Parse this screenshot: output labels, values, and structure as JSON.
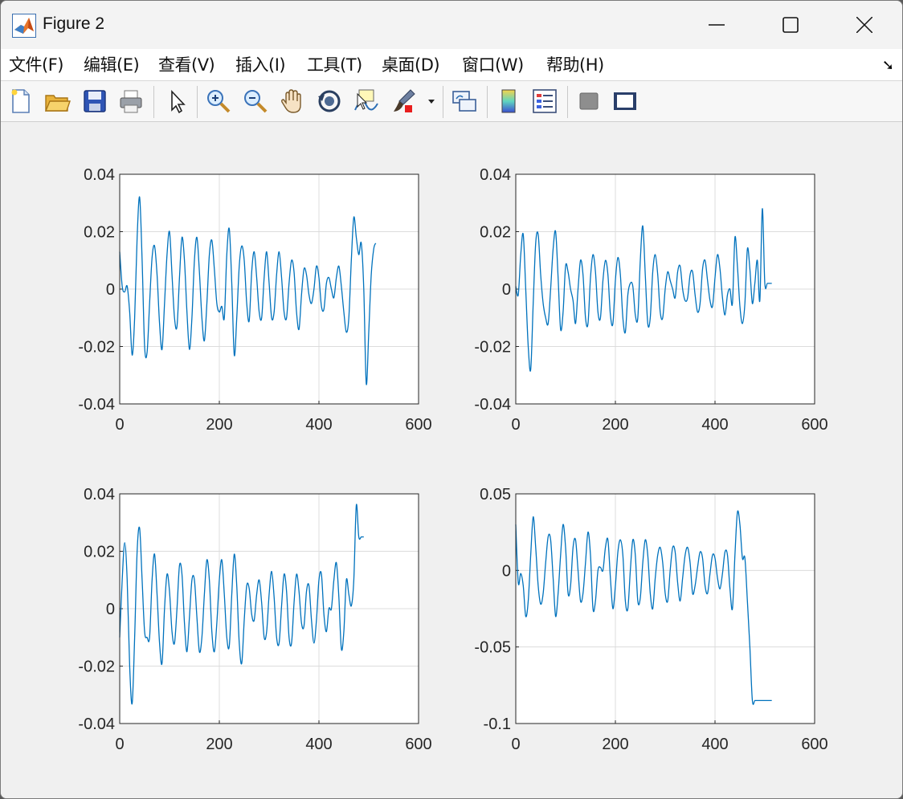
{
  "window": {
    "title": "Figure 2"
  },
  "menu": [
    {
      "label": "文件(F)"
    },
    {
      "label": "编辑(E)"
    },
    {
      "label": "查看(V)"
    },
    {
      "label": "插入(I)"
    },
    {
      "label": "工具(T)"
    },
    {
      "label": "桌面(D)"
    },
    {
      "label": "窗口(W)"
    },
    {
      "label": "帮助(H)"
    }
  ],
  "toolbar": [
    {
      "name": "new-figure-icon"
    },
    {
      "name": "open-file-icon"
    },
    {
      "name": "save-icon"
    },
    {
      "name": "print-icon"
    },
    {
      "name": "select-pointer-icon"
    },
    {
      "name": "zoom-in-icon"
    },
    {
      "name": "zoom-out-icon"
    },
    {
      "name": "pan-hand-icon"
    },
    {
      "name": "rotate-3d-icon"
    },
    {
      "name": "data-cursor-icon"
    },
    {
      "name": "brush-icon"
    },
    {
      "name": "link-plot-icon"
    },
    {
      "name": "colorbar-icon"
    },
    {
      "name": "legend-icon"
    },
    {
      "name": "hide-plot-tools-icon"
    },
    {
      "name": "show-plot-tools-icon"
    }
  ],
  "colors": {
    "line": "#0072BD",
    "grid": "#dcdcdc",
    "axes_bg": "#ffffff"
  },
  "chart_data": [
    {
      "type": "line",
      "xlim": [
        0,
        600
      ],
      "ylim": [
        -0.04,
        0.04
      ],
      "xticks": [
        "0",
        "200",
        "400",
        "600"
      ],
      "yticks": [
        "0.04",
        "0.02",
        "0",
        "-0.02",
        "-0.04"
      ],
      "x": [
        0,
        5,
        10,
        15,
        20,
        25,
        30,
        35,
        40,
        45,
        50,
        55,
        60,
        65,
        70,
        75,
        80,
        85,
        90,
        95,
        100,
        105,
        110,
        115,
        120,
        125,
        130,
        135,
        140,
        145,
        150,
        155,
        160,
        165,
        170,
        175,
        180,
        185,
        190,
        195,
        200,
        205,
        210,
        215,
        220,
        225,
        230,
        235,
        240,
        245,
        250,
        255,
        260,
        265,
        270,
        275,
        280,
        285,
        290,
        295,
        300,
        305,
        310,
        315,
        320,
        325,
        330,
        335,
        340,
        345,
        350,
        355,
        360,
        365,
        370,
        375,
        380,
        385,
        390,
        395,
        400,
        405,
        410,
        415,
        420,
        425,
        430,
        435,
        440,
        445,
        450,
        455,
        460,
        465,
        470,
        475,
        480,
        485,
        490,
        495,
        500,
        505,
        510,
        514
      ],
      "y": [
        0.013,
        0.001,
        -0.001,
        0.001,
        -0.008,
        -0.023,
        -0.01,
        0.018,
        0.032,
        0.01,
        -0.02,
        -0.022,
        -0.005,
        0.011,
        0.015,
        0.005,
        -0.012,
        -0.021,
        -0.005,
        0.012,
        0.02,
        0.005,
        -0.01,
        -0.013,
        0.004,
        0.018,
        0.01,
        -0.008,
        -0.021,
        -0.01,
        0.01,
        0.018,
        0.006,
        -0.01,
        -0.018,
        -0.005,
        0.012,
        0.017,
        0.007,
        -0.005,
        -0.008,
        -0.006,
        -0.01,
        0.012,
        0.021,
        0.002,
        -0.023,
        -0.01,
        0.008,
        0.015,
        0.01,
        -0.005,
        -0.011,
        0.006,
        0.013,
        0.004,
        -0.008,
        -0.01,
        0.004,
        0.013,
        0.002,
        -0.01,
        -0.008,
        0.005,
        0.013,
        0.004,
        -0.008,
        -0.01,
        0.002,
        0.01,
        0.006,
        -0.008,
        -0.014,
        -0.002,
        0.007,
        0.005,
        -0.002,
        -0.005,
        0.0,
        0.008,
        0.004,
        -0.006,
        -0.007,
        0.002,
        0.004,
        0.0,
        -0.003,
        0.004,
        0.008,
        0.001,
        -0.008,
        -0.015,
        -0.01,
        0.01,
        0.025,
        0.018,
        0.012,
        0.016,
        0.0,
        -0.033,
        -0.015,
        0.005,
        0.014,
        0.016
      ],
      "draw_until": 514,
      "end_value": -0.033
    },
    {
      "type": "line",
      "xlim": [
        0,
        600
      ],
      "ylim": [
        -0.04,
        0.04
      ],
      "xticks": [
        "0",
        "200",
        "400",
        "600"
      ],
      "yticks": [
        "0.04",
        "0.02",
        "0",
        "-0.02",
        "-0.04"
      ],
      "x": [
        0,
        5,
        10,
        15,
        20,
        25,
        30,
        35,
        40,
        45,
        50,
        55,
        60,
        65,
        70,
        75,
        80,
        85,
        90,
        95,
        100,
        105,
        110,
        115,
        120,
        125,
        130,
        135,
        140,
        145,
        150,
        155,
        160,
        165,
        170,
        175,
        180,
        185,
        190,
        195,
        200,
        205,
        210,
        215,
        220,
        225,
        230,
        235,
        240,
        245,
        250,
        255,
        260,
        265,
        270,
        275,
        280,
        285,
        290,
        295,
        300,
        305,
        310,
        315,
        320,
        325,
        330,
        335,
        340,
        345,
        350,
        355,
        360,
        365,
        370,
        375,
        380,
        385,
        390,
        395,
        400,
        405,
        410,
        415,
        420,
        425,
        430,
        435,
        440,
        445,
        450,
        455,
        460,
        465,
        470,
        475,
        480,
        485,
        490,
        495,
        500,
        505,
        510,
        514
      ],
      "y": [
        0.001,
        -0.002,
        0.012,
        0.019,
        0.0,
        -0.02,
        -0.028,
        -0.005,
        0.016,
        0.019,
        0.005,
        -0.005,
        -0.01,
        -0.012,
        0.0,
        0.014,
        0.02,
        0.004,
        -0.014,
        -0.008,
        0.008,
        0.006,
        0.0,
        -0.004,
        -0.012,
        0.0,
        0.01,
        0.005,
        -0.01,
        -0.012,
        0.004,
        0.012,
        0.006,
        -0.008,
        -0.01,
        0.003,
        0.01,
        0.005,
        -0.009,
        -0.012,
        0.003,
        0.011,
        0.005,
        -0.01,
        -0.015,
        -0.002,
        0.002,
        0.001,
        -0.009,
        -0.01,
        0.01,
        0.022,
        0.005,
        -0.012,
        -0.01,
        0.006,
        0.012,
        0.005,
        -0.008,
        -0.01,
        0.0,
        0.006,
        0.003,
        0.0,
        -0.003,
        0.006,
        0.008,
        0.0,
        -0.004,
        -0.003,
        0.005,
        0.006,
        -0.002,
        -0.008,
        -0.005,
        0.007,
        0.01,
        0.003,
        -0.004,
        -0.006,
        0.004,
        0.012,
        0.007,
        -0.003,
        -0.009,
        -0.002,
        0.0,
        -0.005,
        0.018,
        0.008,
        -0.006,
        -0.012,
        -0.005,
        0.014,
        0.007,
        -0.005,
        0.002,
        0.01,
        -0.004,
        0.028,
        0.002,
        0.002,
        0.002,
        0.002
      ],
      "draw_until": 514,
      "end_value": 0.002
    },
    {
      "type": "line",
      "xlim": [
        0,
        600
      ],
      "ylim": [
        -0.04,
        0.04
      ],
      "xticks": [
        "0",
        "200",
        "400",
        "600"
      ],
      "yticks": [
        "0.04",
        "0.02",
        "0",
        "-0.02",
        "-0.04"
      ],
      "x": [
        0,
        5,
        10,
        15,
        20,
        25,
        30,
        35,
        40,
        45,
        50,
        55,
        60,
        65,
        70,
        75,
        80,
        85,
        90,
        95,
        100,
        105,
        110,
        115,
        120,
        125,
        130,
        135,
        140,
        145,
        150,
        155,
        160,
        165,
        170,
        175,
        180,
        185,
        190,
        195,
        200,
        205,
        210,
        215,
        220,
        225,
        230,
        235,
        240,
        245,
        250,
        255,
        260,
        265,
        270,
        275,
        280,
        285,
        290,
        295,
        300,
        305,
        310,
        315,
        320,
        325,
        330,
        335,
        340,
        345,
        350,
        355,
        360,
        365,
        370,
        375,
        380,
        385,
        390,
        395,
        400,
        405,
        410,
        415,
        420,
        425,
        430,
        435,
        440,
        445,
        450,
        455,
        460,
        465,
        470,
        475,
        480,
        485,
        490,
        495,
        500,
        505,
        510,
        514
      ],
      "y": [
        -0.01,
        0.01,
        0.023,
        0.01,
        -0.02,
        -0.033,
        -0.01,
        0.02,
        0.028,
        0.01,
        -0.008,
        -0.01,
        -0.01,
        0.01,
        0.019,
        0.005,
        -0.012,
        -0.019,
        0.0,
        0.012,
        0.006,
        -0.008,
        -0.012,
        0.0,
        0.015,
        0.012,
        -0.005,
        -0.015,
        -0.003,
        0.01,
        0.01,
        -0.003,
        -0.015,
        -0.01,
        0.005,
        0.017,
        0.01,
        -0.008,
        -0.015,
        -0.005,
        0.01,
        0.017,
        0.005,
        -0.01,
        -0.013,
        0.005,
        0.019,
        0.008,
        -0.012,
        -0.019,
        -0.004,
        0.008,
        0.007,
        -0.002,
        -0.004,
        0.005,
        0.01,
        0.002,
        -0.01,
        -0.008,
        0.005,
        0.013,
        0.004,
        -0.01,
        -0.012,
        0.001,
        0.012,
        0.006,
        -0.01,
        -0.012,
        0.002,
        0.012,
        0.006,
        -0.005,
        -0.006,
        0.006,
        0.008,
        -0.004,
        -0.012,
        -0.004,
        0.01,
        0.012,
        -0.002,
        -0.008,
        0.0,
        0.0,
        0.01,
        0.016,
        0.004,
        -0.014,
        -0.008,
        0.01,
        0.005,
        0.001,
        0.01,
        0.036,
        0.025,
        0.025,
        0.025,
        0.025
      ],
      "draw_until": 514,
      "end_value": 0.025
    },
    {
      "type": "line",
      "xlim": [
        0,
        600
      ],
      "ylim": [
        -0.1,
        0.05
      ],
      "xticks": [
        "0",
        "200",
        "400",
        "600"
      ],
      "yticks": [
        "0.05",
        "0",
        "-0.05",
        "-0.1"
      ],
      "x": [
        0,
        5,
        10,
        15,
        20,
        25,
        30,
        35,
        40,
        45,
        50,
        55,
        60,
        65,
        70,
        75,
        80,
        85,
        90,
        95,
        100,
        105,
        110,
        115,
        120,
        125,
        130,
        135,
        140,
        145,
        150,
        155,
        160,
        165,
        170,
        175,
        180,
        185,
        190,
        195,
        200,
        205,
        210,
        215,
        220,
        225,
        230,
        235,
        240,
        245,
        250,
        255,
        260,
        265,
        270,
        275,
        280,
        285,
        290,
        295,
        300,
        305,
        310,
        315,
        320,
        325,
        330,
        335,
        340,
        345,
        350,
        355,
        360,
        365,
        370,
        375,
        380,
        385,
        390,
        395,
        400,
        405,
        410,
        415,
        420,
        425,
        430,
        435,
        440,
        445,
        450,
        455,
        460,
        465,
        470,
        475,
        480,
        485,
        490,
        495,
        500,
        505,
        510,
        514
      ],
      "y": [
        0.03,
        -0.008,
        -0.002,
        -0.01,
        -0.03,
        -0.02,
        0.01,
        0.035,
        0.015,
        -0.01,
        -0.022,
        -0.015,
        0.005,
        0.022,
        0.02,
        -0.005,
        -0.03,
        -0.015,
        0.01,
        0.03,
        0.015,
        -0.015,
        -0.01,
        0.015,
        0.02,
        0.0,
        -0.02,
        -0.015,
        0.005,
        0.025,
        0.01,
        -0.025,
        -0.02,
        0.0,
        0.002,
        0.0,
        0.015,
        0.02,
        -0.005,
        -0.025,
        -0.01,
        0.012,
        0.02,
        0.01,
        -0.02,
        -0.025,
        0.0,
        0.02,
        0.01,
        -0.02,
        -0.018,
        0.005,
        0.02,
        0.01,
        -0.015,
        -0.025,
        -0.005,
        0.01,
        0.015,
        0.005,
        -0.015,
        -0.02,
        0.0,
        0.015,
        0.012,
        -0.008,
        -0.02,
        -0.005,
        0.01,
        0.015,
        0.005,
        -0.015,
        -0.01,
        0.002,
        0.012,
        0.008,
        -0.01,
        -0.015,
        -0.002,
        0.01,
        0.008,
        -0.005,
        -0.012,
        -0.002,
        0.012,
        0.01,
        -0.012,
        -0.025,
        0.01,
        0.038,
        0.03,
        0.008,
        0.008,
        -0.02,
        -0.05,
        -0.085,
        -0.085,
        -0.085,
        -0.085,
        -0.085,
        -0.085,
        -0.085,
        -0.085,
        -0.085
      ],
      "draw_until": 514,
      "end_value": -0.085
    }
  ]
}
